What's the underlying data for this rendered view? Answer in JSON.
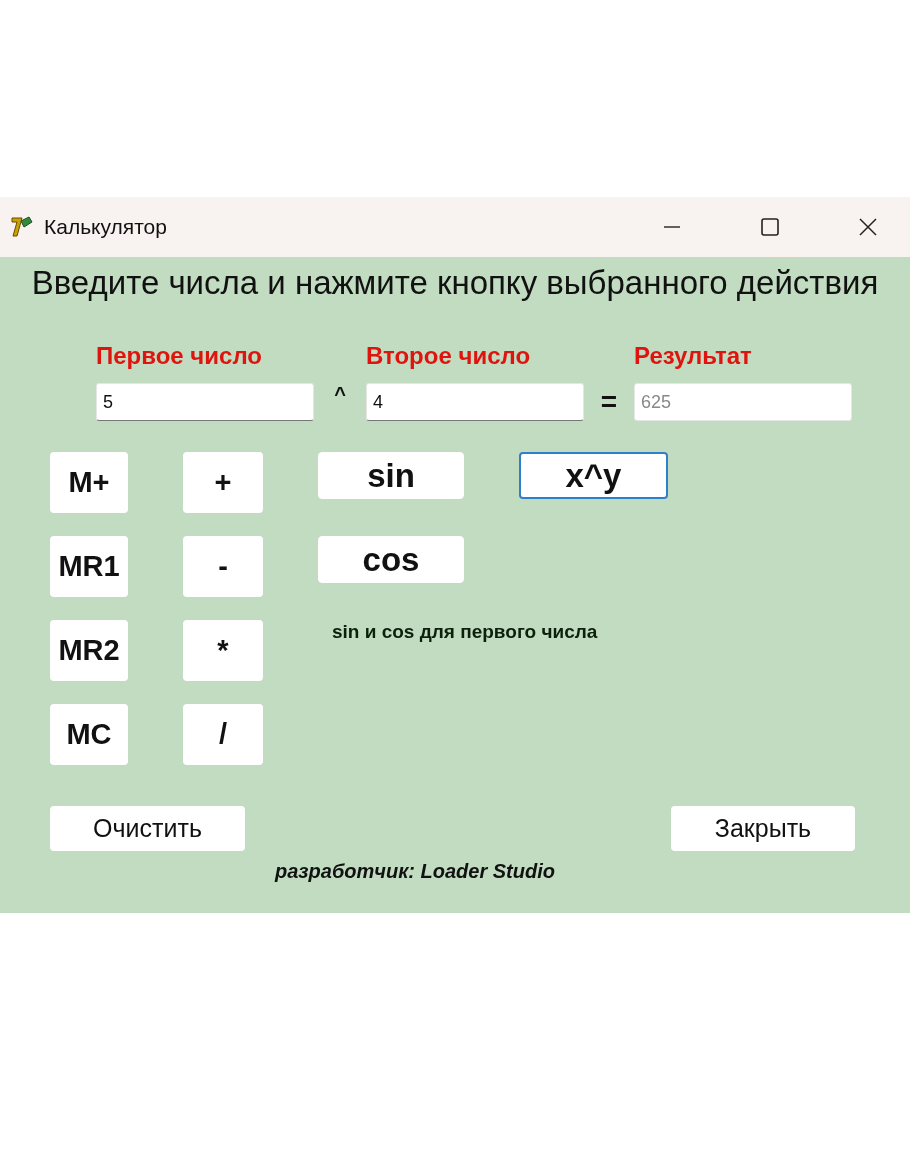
{
  "window": {
    "title": "Калькулятор"
  },
  "heading": "Введите числа и нажмите кнопку выбранного действия",
  "inputs": [
    {
      "label": "Первое число",
      "value": "5",
      "disabled": false
    },
    {
      "label": "Второе число",
      "value": "4",
      "disabled": false
    },
    {
      "label": "Результат",
      "value": "625",
      "disabled": true
    }
  ],
  "operator_sign": "^",
  "equals_sign": "=",
  "memory_buttons": [
    "M+",
    "MR1",
    "MR2",
    "MC"
  ],
  "operation_buttons": [
    "+",
    "-",
    "*",
    "/"
  ],
  "function_buttons": [
    {
      "label": "sin",
      "selected": false
    },
    {
      "label": "x^y",
      "selected": true
    },
    {
      "label": "cos",
      "selected": false
    }
  ],
  "note": "sin и cos для первого числа",
  "clear_button": "Очистить",
  "close_button": "Закрыть",
  "developer": "разработчик: Loader Studio"
}
